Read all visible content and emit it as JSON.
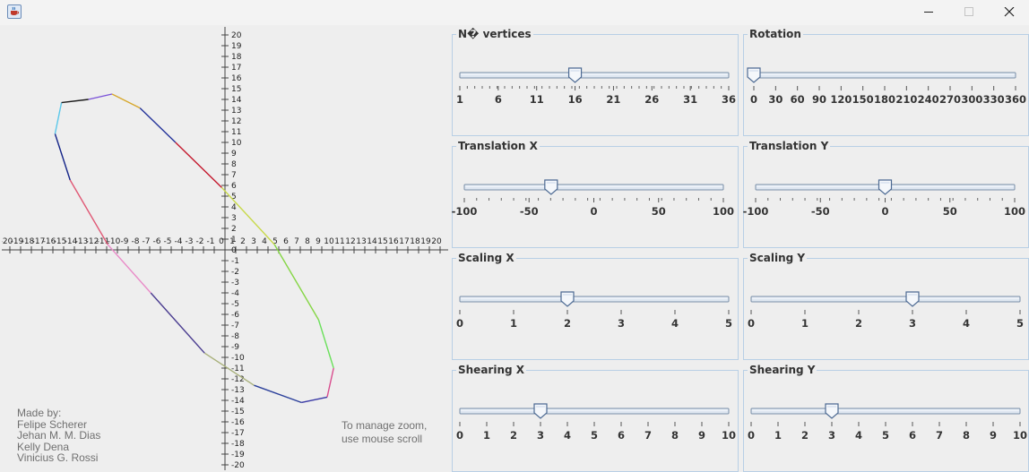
{
  "window": {
    "icon": "java-cup-icon",
    "controls": [
      "minimize-icon",
      "maximize-icon",
      "close-icon"
    ]
  },
  "plane": {
    "x_labels": [
      "-20",
      "-19",
      "-18",
      "-17",
      "-16",
      "-15",
      "-14",
      "-13",
      "-12",
      "-11",
      "-10",
      "-9",
      "-8",
      "-7",
      "-6",
      "-5",
      "-4",
      "-3",
      "-2",
      "-1",
      "0",
      "1",
      "2",
      "3",
      "4",
      "5",
      "6",
      "7",
      "8",
      "9",
      "10",
      "11",
      "12",
      "13",
      "14",
      "15",
      "16",
      "17",
      "18",
      "19",
      "20"
    ],
    "y_labels": [
      "20",
      "19",
      "18",
      "17",
      "16",
      "15",
      "14",
      "13",
      "12",
      "11",
      "10",
      "9",
      "8",
      "7",
      "6",
      "5",
      "4",
      "3",
      "2",
      "1",
      "0",
      "-1",
      "-2",
      "-3",
      "-4",
      "-5",
      "-6",
      "-7",
      "-8",
      "-9",
      "-10",
      "-11",
      "-12",
      "-13",
      "-14",
      "-15",
      "-16",
      "-17",
      "-18",
      "-19",
      "-20"
    ],
    "polygon": [
      {
        "x": -12.7,
        "y": 14.0
      },
      {
        "x": -10.5,
        "y": 14.5
      },
      {
        "x": -7.9,
        "y": 13.2
      },
      {
        "x": -4.6,
        "y": 10.0
      },
      {
        "x": -0.3,
        "y": 5.8
      },
      {
        "x": 4.6,
        "y": 0.5
      },
      {
        "x": 8.7,
        "y": -6.5
      },
      {
        "x": 10.1,
        "y": -11.0
      },
      {
        "x": 9.5,
        "y": -13.7
      },
      {
        "x": 7.1,
        "y": -14.2
      },
      {
        "x": 2.7,
        "y": -12.6
      },
      {
        "x": -1.9,
        "y": -9.6
      },
      {
        "x": -6.9,
        "y": -4.0
      },
      {
        "x": -10.9,
        "y": 0.5
      },
      {
        "x": -14.4,
        "y": 6.5
      },
      {
        "x": -15.8,
        "y": 10.8
      },
      {
        "x": -15.2,
        "y": 13.7
      }
    ],
    "edge_colors": [
      "#7a52d8",
      "#d7a72a",
      "#24339a",
      "#c4182d",
      "#c8d94a",
      "#85d645",
      "#6ae05a",
      "#d94d8e",
      "#3a3aa6",
      "#2a3f9a",
      "#a8b07a",
      "#4a3c90",
      "#e98cc8",
      "#e05875",
      "#142488",
      "#5bc8ea",
      "#1a1a1a"
    ]
  },
  "credits": {
    "heading": "Made by:",
    "names": [
      "Felipe Scherer",
      "Jehan M. M. Dias",
      "Kelly Dena",
      "Vinicius G. Rossi"
    ]
  },
  "zoom_hint": {
    "line1": "To manage zoom,",
    "line2": "use mouse scroll"
  },
  "controls": [
    {
      "id": "vertices",
      "title": "N� vertices",
      "min": 1,
      "max": 36,
      "value": 16,
      "labels": [
        "1",
        "6",
        "11",
        "16",
        "21",
        "26",
        "31",
        "36"
      ],
      "minor_ticks": 36
    },
    {
      "id": "rotation",
      "title": "Rotation",
      "min": 0,
      "max": 360,
      "value": 0,
      "labels": [
        "0",
        "30",
        "60",
        "90",
        "120",
        "150",
        "180",
        "210",
        "240",
        "270",
        "300",
        "330",
        "360"
      ],
      "minor_ticks": 0
    },
    {
      "id": "translation-x",
      "title": "Translation X",
      "min": -100,
      "max": 100,
      "value": -33,
      "labels": [
        "-100",
        "-50",
        "0",
        "50",
        "100"
      ],
      "minor_ticks": 21
    },
    {
      "id": "translation-y",
      "title": "Translation Y",
      "min": -100,
      "max": 100,
      "value": 0,
      "labels": [
        "-100",
        "-50",
        "0",
        "50",
        "100"
      ],
      "minor_ticks": 21
    },
    {
      "id": "scaling-x",
      "title": "Scaling X",
      "min": 0,
      "max": 5,
      "value": 2,
      "labels": [
        "0",
        "1",
        "2",
        "3",
        "4",
        "5"
      ],
      "minor_ticks": 0
    },
    {
      "id": "scaling-y",
      "title": "Scaling Y",
      "min": 0,
      "max": 5,
      "value": 3,
      "labels": [
        "0",
        "1",
        "2",
        "3",
        "4",
        "5"
      ],
      "minor_ticks": 0
    },
    {
      "id": "shearing-x",
      "title": "Shearing X",
      "min": 0,
      "max": 10,
      "value": 3,
      "labels": [
        "0",
        "1",
        "2",
        "3",
        "4",
        "5",
        "6",
        "7",
        "8",
        "9",
        "10"
      ],
      "minor_ticks": 0
    },
    {
      "id": "shearing-y",
      "title": "Shearing Y",
      "min": 0,
      "max": 10,
      "value": 3,
      "labels": [
        "0",
        "1",
        "2",
        "3",
        "4",
        "5",
        "6",
        "7",
        "8",
        "9",
        "10"
      ],
      "minor_ticks": 0
    }
  ]
}
